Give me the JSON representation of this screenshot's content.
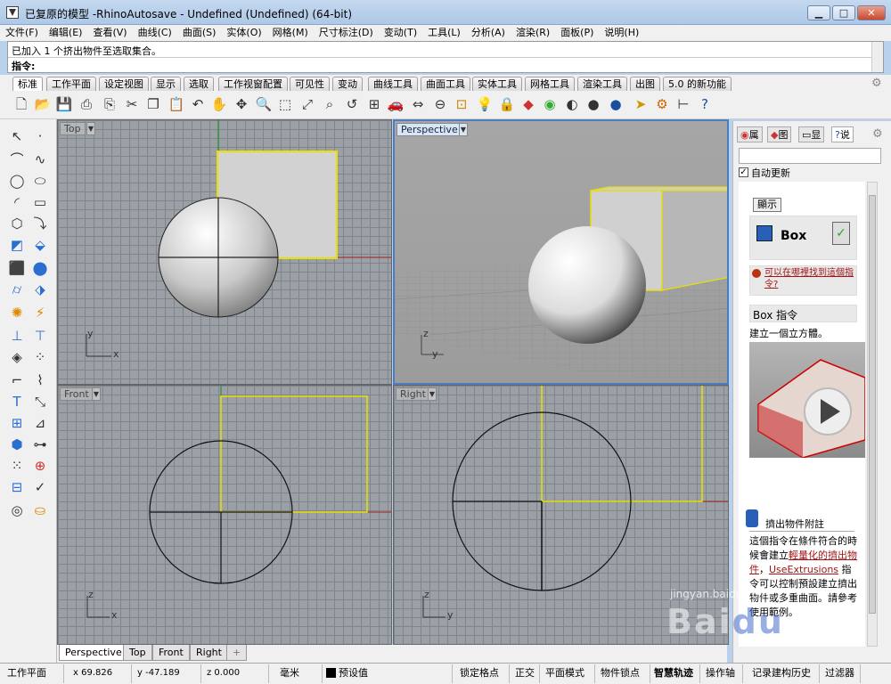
{
  "title": "已复原的模型 -RhinoAutosave - Undefined (Undefined) (64-bit)",
  "window_buttons": {
    "min": "▁",
    "max": "□",
    "close": "✕"
  },
  "menu": [
    "文件(F)",
    "编辑(E)",
    "查看(V)",
    "曲线(C)",
    "曲面(S)",
    "实体(O)",
    "网格(M)",
    "尺寸标注(D)",
    "变动(T)",
    "工具(L)",
    "分析(A)",
    "渲染(R)",
    "面板(P)",
    "说明(H)"
  ],
  "command": {
    "history": "已加入 1 个挤出物件至选取集合。",
    "prompt": "指令:"
  },
  "tabs": [
    "标准",
    "工作平面",
    "设定视图",
    "显示",
    "选取",
    "工作视窗配置",
    "可见性",
    "变动",
    "曲线工具",
    "曲面工具",
    "实体工具",
    "网格工具",
    "渲染工具",
    "出图",
    "5.0 的新功能"
  ],
  "viewports": {
    "top": {
      "label": "Top"
    },
    "perspective": {
      "label": "Perspective"
    },
    "front": {
      "label": "Front"
    },
    "right": {
      "label": "Right"
    }
  },
  "axes": {
    "x": "x",
    "y": "y",
    "z": "z"
  },
  "viewport_tabs": [
    "Perspective",
    "Top",
    "Front",
    "Right"
  ],
  "viewport_add": "+",
  "right_panel": {
    "tabs": [
      "属",
      "图",
      "显",
      "说"
    ],
    "auto_update": "自动更新",
    "show_button": "顯示",
    "command_name": "Box",
    "where_link": "可以在哪裡找到這個指令?",
    "section_title": "Box 指令",
    "description": "建立一個立方體。",
    "sub_title": "擠出物件附註",
    "para_1": "這個指令在條件符合的時候會建立",
    "para_1_link": "輕量化的擠出物件",
    "para_2_link": "UseExtrusions",
    "para_2": "指令可以控制預設建立擠出物件或多重曲面。請參考使用範例。"
  },
  "watermark": "jingyan.baidu.com",
  "status": {
    "cplane": "工作平面",
    "x": "x 69.826",
    "y": "y -47.189",
    "z": "z 0.000",
    "unit": "毫米",
    "layer": "预设值",
    "items": [
      "锁定格点",
      "正交",
      "平面模式",
      "物件锁点",
      "智慧轨迹",
      "操作轴",
      "记录建构历史",
      "过滤器"
    ]
  }
}
